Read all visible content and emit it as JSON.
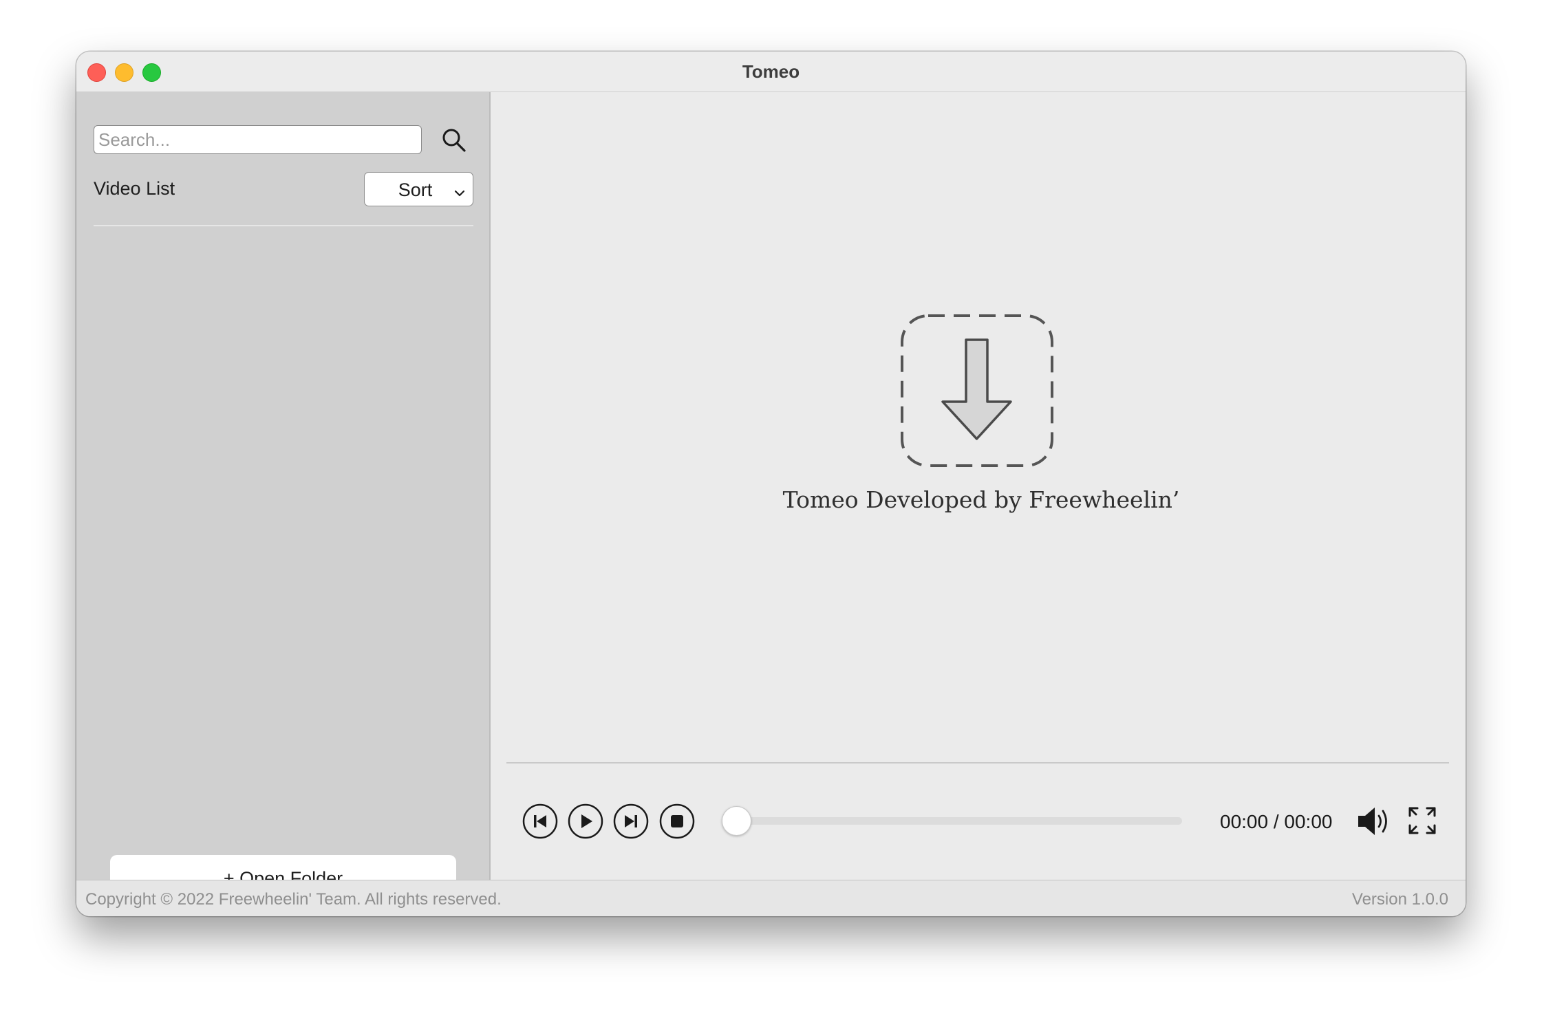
{
  "window": {
    "title": "Tomeo"
  },
  "sidebar": {
    "search": {
      "placeholder": "Search...",
      "value": ""
    },
    "list_title": "Video List",
    "sort_label": "Sort",
    "open_folder_label": "+ Open Folder"
  },
  "main": {
    "drop_text": "Tomeo Developed by Freewheelin’"
  },
  "controls": {
    "time": "00:00 / 00:00",
    "progress": 0
  },
  "statusbar": {
    "copyright": "Copyright © 2022 Freewheelin' Team. All rights reserved.",
    "version": "Version 1.0.0"
  },
  "icons": {
    "search": "search-icon",
    "sort_chevron": "chevron-down-icon",
    "drop": "download-arrow-icon",
    "prev": "skip-back-icon",
    "play": "play-icon",
    "next": "skip-forward-icon",
    "stop": "stop-icon",
    "volume": "volume-icon",
    "fullscreen": "fullscreen-icon"
  },
  "colors": {
    "close": "#fe5f57",
    "minimize": "#febc2e",
    "maximize": "#28c840",
    "sidebar_bg": "#d0d0d0",
    "main_bg": "#ebebeb"
  }
}
